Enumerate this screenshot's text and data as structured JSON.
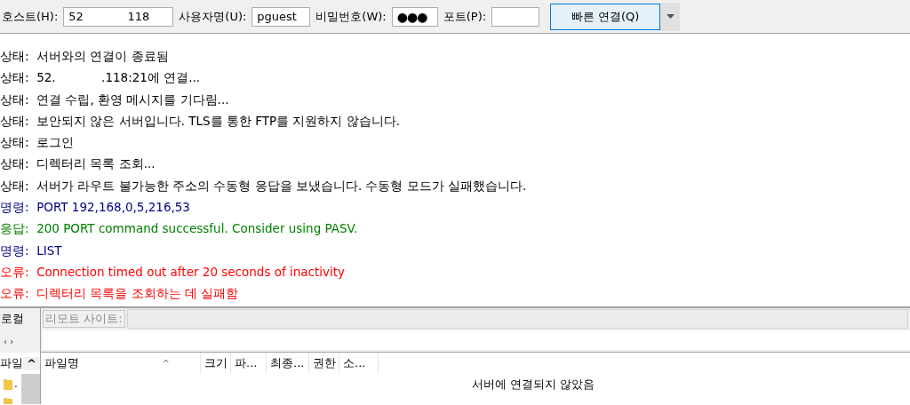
{
  "toolbar": {
    "fields": [
      {
        "label": "호스트(H):",
        "value": "52            118",
        "kind": "text"
      },
      {
        "label": "사용자명(U):",
        "value": "pguest",
        "kind": "text"
      },
      {
        "label": "비밀번호(W):",
        "value": "●●●",
        "kind": "password"
      },
      {
        "label": "포트(P):",
        "kind": "text"
      }
    ],
    "connect_button": "빠른 연결(Q)"
  },
  "log": [
    {
      "kind": "status",
      "prefix": "상태:",
      "text": "서버와의 연결이 종료됨"
    },
    {
      "kind": "status",
      "prefix": "상태:",
      "text": "52.            .118:21에 연결..."
    },
    {
      "kind": "status",
      "prefix": "상태:",
      "text": "연결 수립, 환영 메시지를 기다림..."
    },
    {
      "kind": "status",
      "prefix": "상태:",
      "text": "보안되지 않은 서버입니다. TLS를 통한 FTP를 지원하지 않습니다."
    },
    {
      "kind": "status",
      "prefix": "상태:",
      "text": "로그인"
    },
    {
      "kind": "status",
      "prefix": "상태:",
      "text": "디렉터리 목록 조회..."
    },
    {
      "kind": "status",
      "prefix": "상태:",
      "text": "서버가 라우트 불가능한 주소의 수동형 응답을 보냈습니다. 수동형 모드가 실패했습니다."
    },
    {
      "kind": "command",
      "prefix": "명령:",
      "text": "PORT 192,168,0,5,216,53"
    },
    {
      "kind": "response",
      "prefix": "응답:",
      "text": "200 PORT command successful. Consider using PASV."
    },
    {
      "kind": "command",
      "prefix": "명령:",
      "text": "LIST"
    },
    {
      "kind": "error",
      "prefix": "오류:",
      "text": "Connection timed out after 20 seconds of inactivity"
    },
    {
      "kind": "error",
      "prefix": "오류:",
      "text": "디렉터리 목록을 조회하는 데 실패함"
    }
  ],
  "local": {
    "label": "로컬",
    "nav": "‹ ›",
    "column": "파일",
    "scroll_up": "^",
    "items": [
      {
        "kind": "folder",
        "name": "."
      },
      {
        "kind": "folder"
      }
    ]
  },
  "remote": {
    "label": "리모트 사이트:",
    "columns": [
      {
        "label": "파일명",
        "sort": "^"
      },
      {
        "label": "크기"
      },
      {
        "label": "파..."
      },
      {
        "label": "최종..."
      },
      {
        "label": "권한"
      },
      {
        "label": "소..."
      }
    ],
    "message": "서버에 연결되지 않았음"
  }
}
